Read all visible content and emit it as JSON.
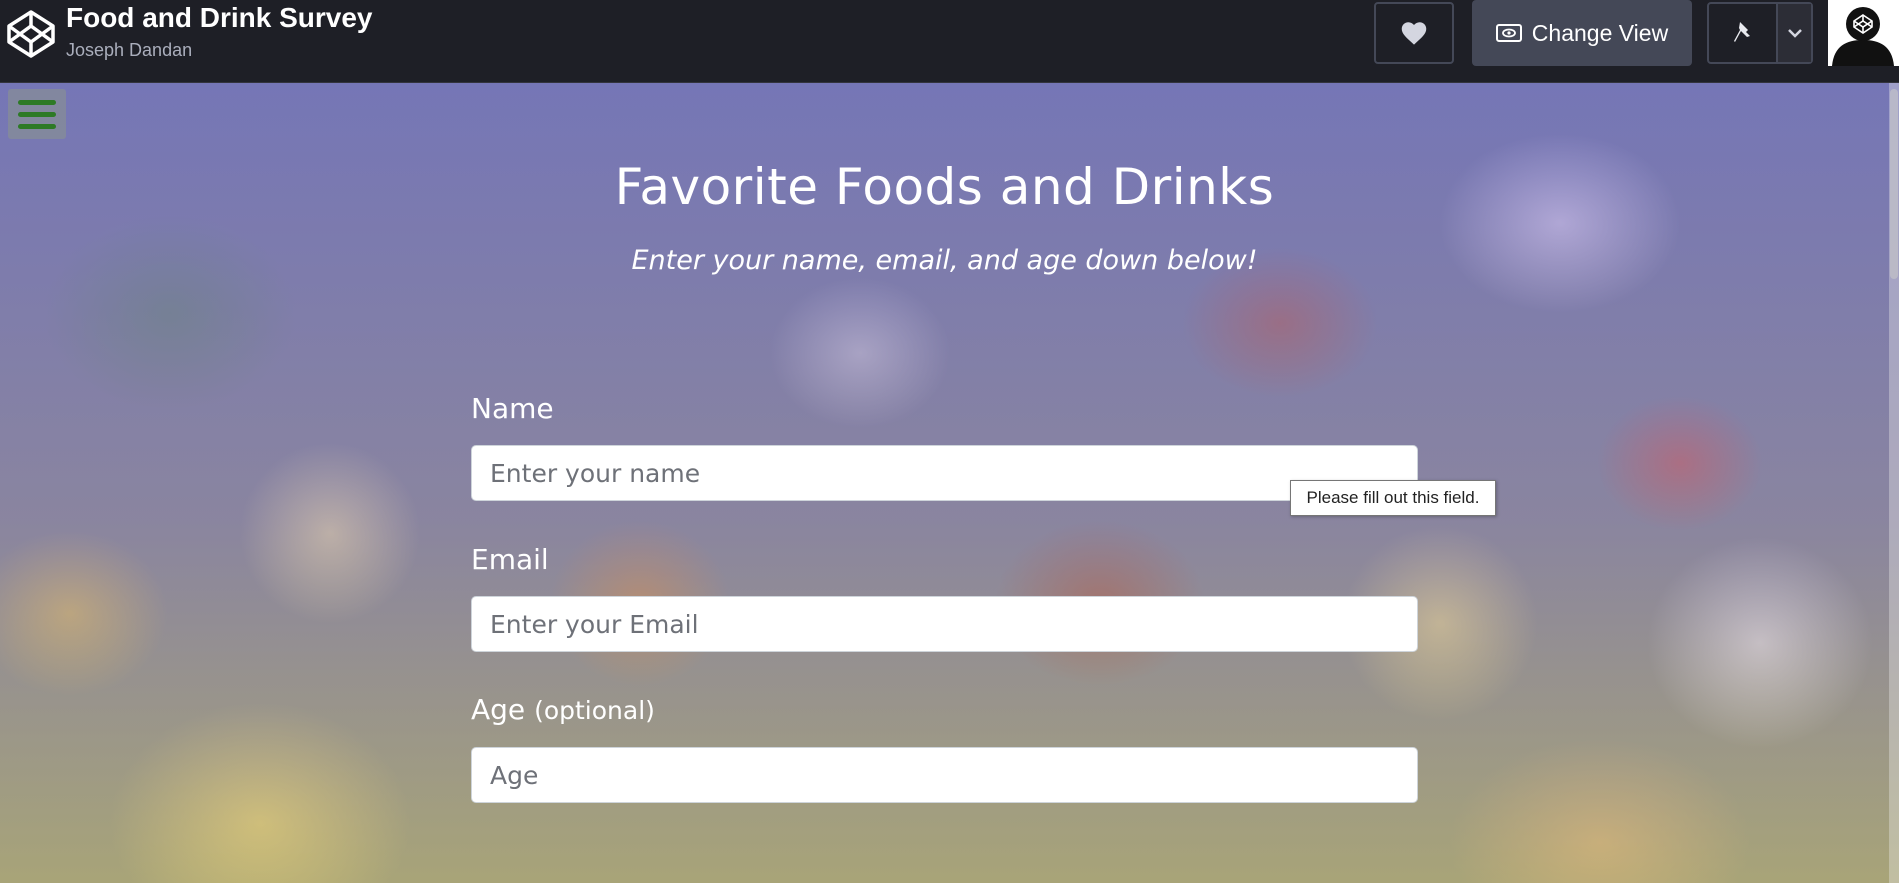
{
  "header": {
    "title": "Food and Drink Survey",
    "author": "Joseph Dandan",
    "change_view_label": "Change View"
  },
  "survey": {
    "heading": "Favorite Foods and Drinks",
    "subheading": "Enter your name, email, and age down below!",
    "name_label": "Name",
    "name_placeholder": "Enter your name",
    "email_label": "Email",
    "email_placeholder": "Enter your Email",
    "age_label": "Age",
    "age_optional": "(optional)",
    "age_placeholder": "Age",
    "validation_tooltip": "Please fill out this field."
  },
  "colors": {
    "topbar_bg": "#1e1f26",
    "button_bg": "#444857",
    "menu_accent": "#2d7a26",
    "overlay_tint": "#7c7cd6"
  },
  "icons": [
    "codepen-logo-icon",
    "heart-icon",
    "eye-icon",
    "pin-icon",
    "chevron-down-icon",
    "hamburger-menu-icon",
    "user-avatar-icon"
  ]
}
